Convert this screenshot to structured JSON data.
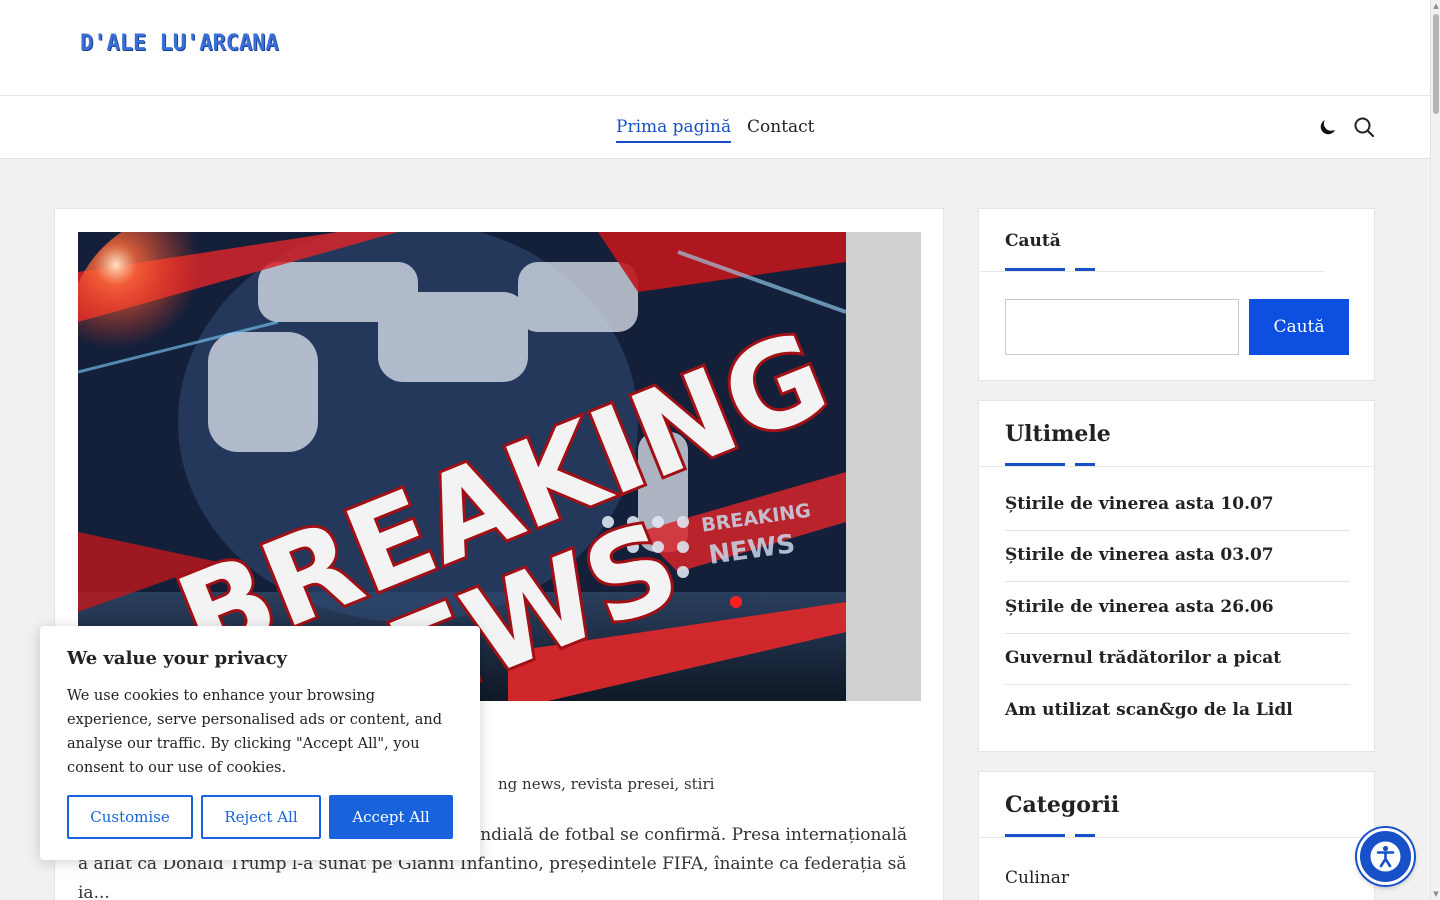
{
  "site": {
    "logo_text": "D'ALE LU'ARCANA"
  },
  "nav": {
    "items": [
      {
        "label": "Prima pagină",
        "active": true
      },
      {
        "label": "Contact",
        "active": false
      }
    ],
    "icons": [
      "moon-icon",
      "search-icon"
    ]
  },
  "post": {
    "image_text_1": "BREAKING",
    "image_text_2": "NEWS",
    "image_small_text_1": "BREAKING",
    "image_small_text_2": "NEWS",
    "meta_visible": "ng news, revista presei, stiri",
    "excerpt_line1": "ondială de fotbal se confirmă. Presa internațională",
    "excerpt_line2": "a aflat că Donald Trump l-a sunat pe Gianni Infantino, președintele FIFA, înainte ca federația să",
    "excerpt_line3": "ia..."
  },
  "sidebar": {
    "search": {
      "title": "Caută",
      "button_label": "Caută",
      "input_value": ""
    },
    "recent": {
      "title": "Ultimele",
      "items": [
        "Știrile de vinerea asta 10.07",
        "Știrile de vinerea asta 03.07",
        "Știrile de vinerea asta 26.06",
        "Guvernul trădătorilor a picat",
        "Am utilizat scan&go de la Lidl"
      ]
    },
    "categories": {
      "title": "Categorii",
      "items": [
        "Culinar"
      ]
    }
  },
  "cookie": {
    "title": "We value your privacy",
    "text": "We use cookies to enhance your browsing experience, serve personalised ads or content, and analyse our traffic. By clicking \"Accept All\", you consent to our use of cookies.",
    "buttons": {
      "customise": "Customise",
      "reject": "Reject All",
      "accept": "Accept All"
    }
  },
  "colors": {
    "accent": "#1750c7",
    "button_blue": "#0d4fe0",
    "cookie_blue": "#1863dc"
  },
  "accessibility_button": {
    "icon": "accessibility-icon"
  }
}
